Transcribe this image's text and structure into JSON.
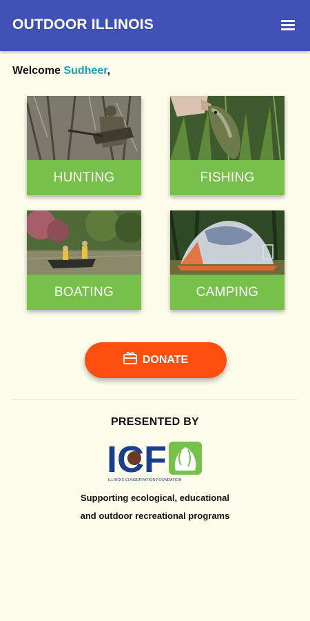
{
  "app": {
    "title": "OUTDOOR ILLINOIS",
    "menu_icon": "hamburger-menu-icon"
  },
  "welcome": {
    "prefix": "Welcome ",
    "user": "Sudheer",
    "suffix": ","
  },
  "tiles": [
    {
      "label": "HUNTING"
    },
    {
      "label": "FISHING"
    },
    {
      "label": "BOATING"
    },
    {
      "label": "CAMPING"
    }
  ],
  "donate": {
    "label": "DONATE",
    "icon": "gift-card-icon"
  },
  "footer": {
    "presented_by": "PRESENTED BY",
    "logo_text": "ICF",
    "logo_subtitle": "ILLINOIS CONSERVATION FOUNDATION",
    "tagline_line1": "Supporting ecological, educational",
    "tagline_line2": "and outdoor recreational programs"
  },
  "colors": {
    "appbar": "#3f51b5",
    "background": "#fdfdeb",
    "tile_green": "#77c04a",
    "donate_orange": "#ff4f0f",
    "username_teal": "#1aa0b5",
    "logo_blue": "#1b3f8f"
  }
}
